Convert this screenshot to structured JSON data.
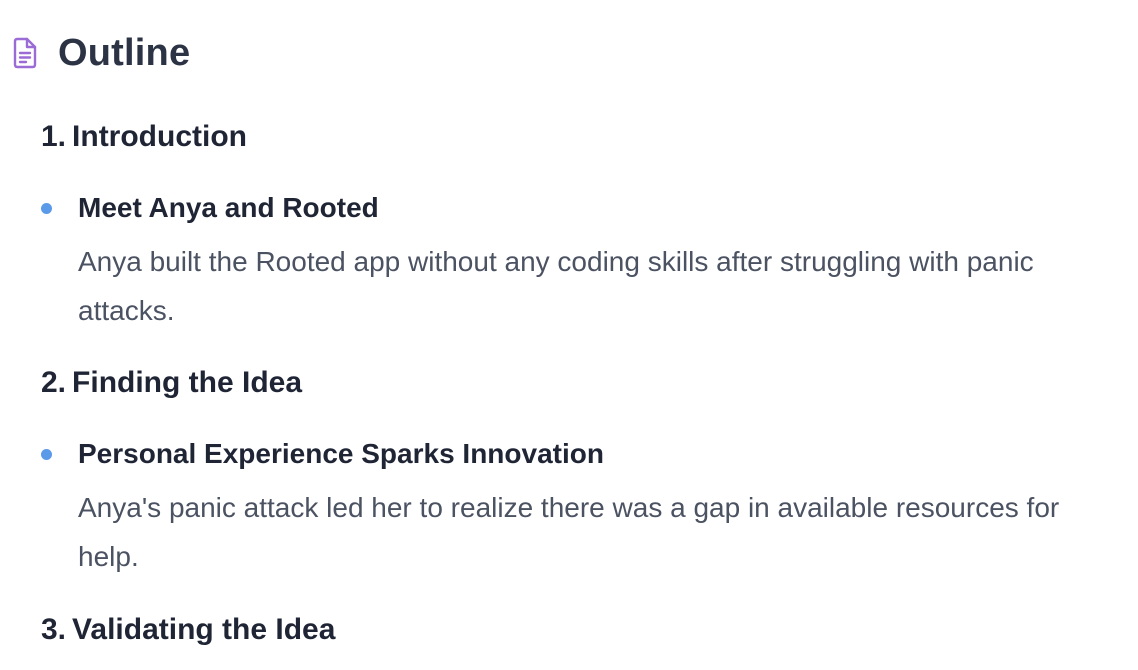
{
  "header": {
    "icon": "document-icon",
    "accent_color": "#9b6bd6",
    "title": "Outline"
  },
  "sections": [
    {
      "number": "1.",
      "heading": "Introduction",
      "bullet_title": "Meet Anya and Rooted",
      "bullet_desc": "Anya built the Rooted app without any coding skills after struggling with panic attacks."
    },
    {
      "number": "2.",
      "heading": "Finding the Idea",
      "bullet_title": "Personal Experience Sparks Innovation",
      "bullet_desc": "Anya's panic attack led her to realize there was a gap in available resources for help."
    },
    {
      "number": "3.",
      "heading": "Validating the Idea"
    }
  ],
  "colors": {
    "bullet": "#5b9ae8",
    "heading": "#1f2535",
    "body_text": "#4b5262"
  }
}
